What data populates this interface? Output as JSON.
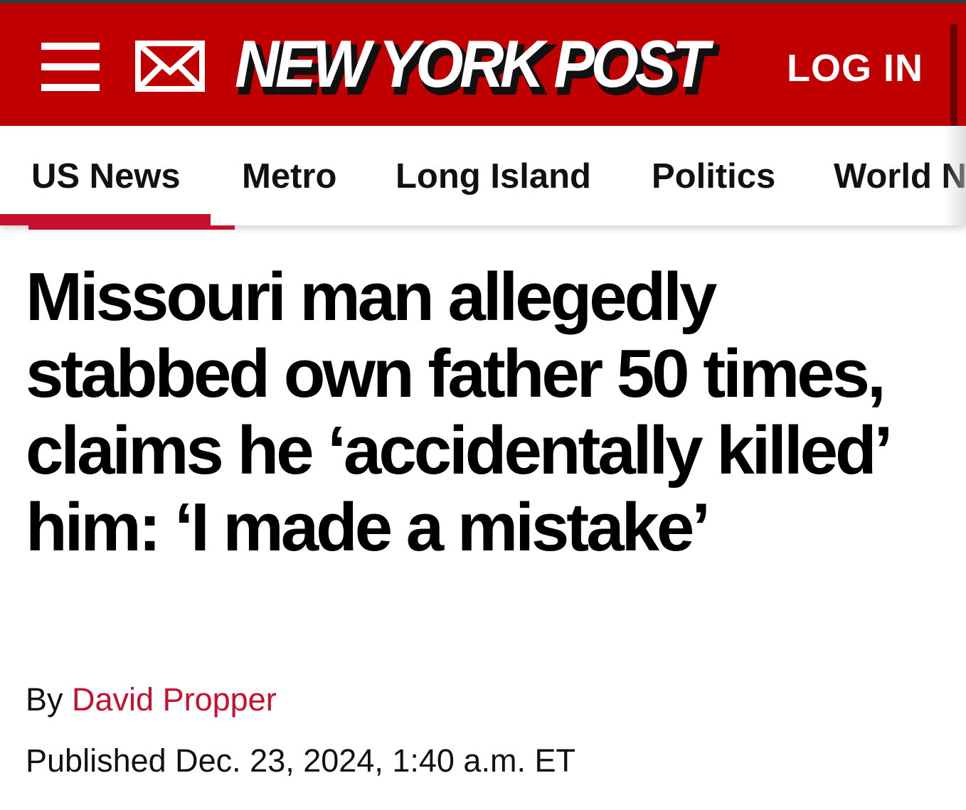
{
  "header": {
    "logo_text": "NEW YORK POST",
    "login_label": "LOG IN",
    "menu_icon": "hamburger-menu-icon",
    "mail_icon": "envelope-icon",
    "brand_color": "#c00000"
  },
  "nav": {
    "items": [
      {
        "label": "US News",
        "active": true
      },
      {
        "label": "Metro",
        "active": false
      },
      {
        "label": "Long Island",
        "active": false
      },
      {
        "label": "Politics",
        "active": false
      },
      {
        "label": "World N",
        "active": false
      }
    ],
    "active_color": "#c8102e"
  },
  "article": {
    "headline": "Missouri man allegedly stabbed own father 50 times, claims he ‘accidentally killed’ him: ‘I made a mistake’",
    "byline_prefix": "By",
    "author": "David Propper",
    "published": "Published Dec. 23, 2024, 1:40 a.m. ET"
  }
}
